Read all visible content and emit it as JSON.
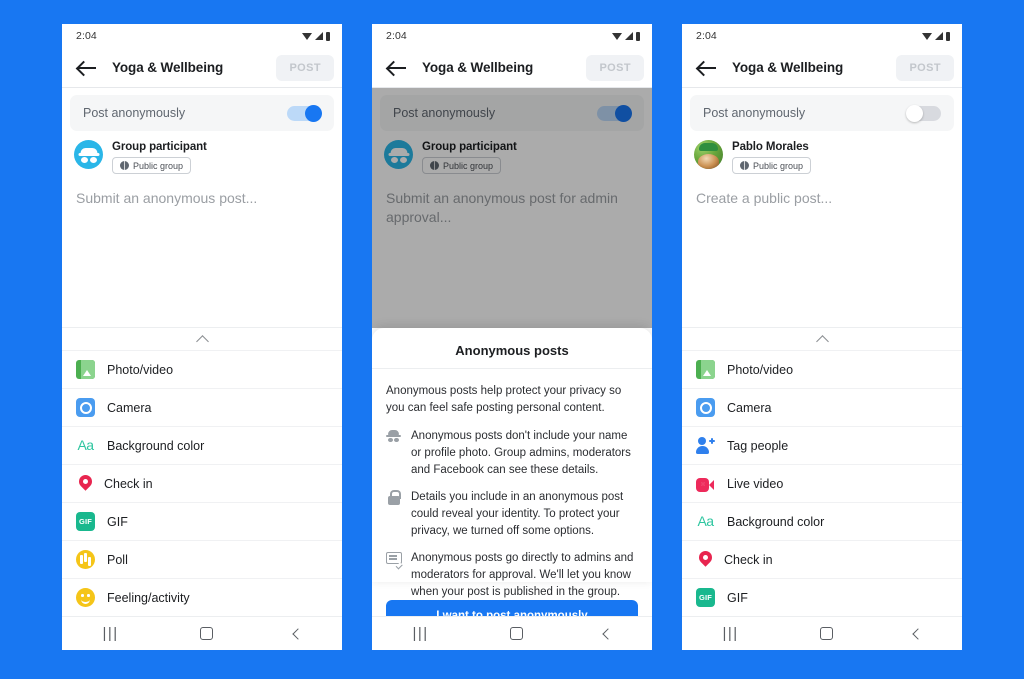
{
  "background_color": "#1877F2",
  "accent_color": "#1877F2",
  "status_bar": {
    "time": "2:04",
    "icons": [
      "wifi-icon",
      "signal-icon",
      "battery-icon"
    ]
  },
  "app_bar": {
    "back_icon": "back-arrow-icon",
    "title": "Yoga & Wellbeing",
    "post_label": "POST"
  },
  "panels": [
    {
      "id": "anonymous-enabled",
      "anon_toggle": {
        "label": "Post anonymously",
        "state": "on"
      },
      "identity": {
        "avatar": "incognito-icon",
        "name": "Group participant",
        "chip": {
          "icon": "globe-icon",
          "label": "Public group"
        }
      },
      "composer_placeholder": "Submit an anonymous post...",
      "chevron": "chevron-up-icon",
      "options": [
        {
          "icon": "photo-video-icon",
          "label": "Photo/video"
        },
        {
          "icon": "camera-icon",
          "label": "Camera"
        },
        {
          "icon": "background-color-icon",
          "label": "Background color"
        },
        {
          "icon": "check-in-icon",
          "label": "Check in"
        },
        {
          "icon": "gif-icon",
          "label": "GIF"
        },
        {
          "icon": "poll-icon",
          "label": "Poll"
        },
        {
          "icon": "feeling-activity-icon",
          "label": "Feeling/activity"
        }
      ]
    },
    {
      "id": "anonymous-info-sheet",
      "anon_toggle": {
        "label": "Post anonymously",
        "state": "on"
      },
      "identity": {
        "avatar": "incognito-icon",
        "name": "Group participant",
        "chip": {
          "icon": "globe-icon",
          "label": "Public group"
        }
      },
      "composer_placeholder": "Submit an anonymous post for admin approval...",
      "sheet": {
        "title": "Anonymous posts",
        "intro": "Anonymous posts help protect your privacy so you can feel safe posting personal content.",
        "points": [
          {
            "icon": "incognito-icon",
            "text": "Anonymous posts don't include your name or profile photo. Group admins, moderators and Facebook can see these details."
          },
          {
            "icon": "lock-icon",
            "text": "Details you include in an anonymous post could reveal your identity. To protect your privacy, we turned off some options."
          },
          {
            "icon": "approval-icon",
            "text": "Anonymous posts go directly to admins and moderators for approval. We'll let you know when your post is published in the group."
          }
        ],
        "cta_label": "I want to post anonymously"
      }
    },
    {
      "id": "public-post",
      "anon_toggle": {
        "label": "Post anonymously",
        "state": "off"
      },
      "identity": {
        "avatar": "profile-photo",
        "name": "Pablo Morales",
        "chip": {
          "icon": "globe-icon",
          "label": "Public group"
        }
      },
      "composer_placeholder": "Create a public post...",
      "chevron": "chevron-up-icon",
      "options": [
        {
          "icon": "photo-video-icon",
          "label": "Photo/video"
        },
        {
          "icon": "camera-icon",
          "label": "Camera"
        },
        {
          "icon": "tag-people-icon",
          "label": "Tag people"
        },
        {
          "icon": "live-video-icon",
          "label": "Live video"
        },
        {
          "icon": "background-color-icon",
          "label": "Background color"
        },
        {
          "icon": "check-in-icon",
          "label": "Check in"
        },
        {
          "icon": "gif-icon",
          "label": "GIF"
        }
      ]
    }
  ],
  "nav_bar": {
    "recents_icon": "recents-icon",
    "recents_glyph": "|||",
    "home_icon": "home-icon",
    "back_icon": "back-icon"
  }
}
